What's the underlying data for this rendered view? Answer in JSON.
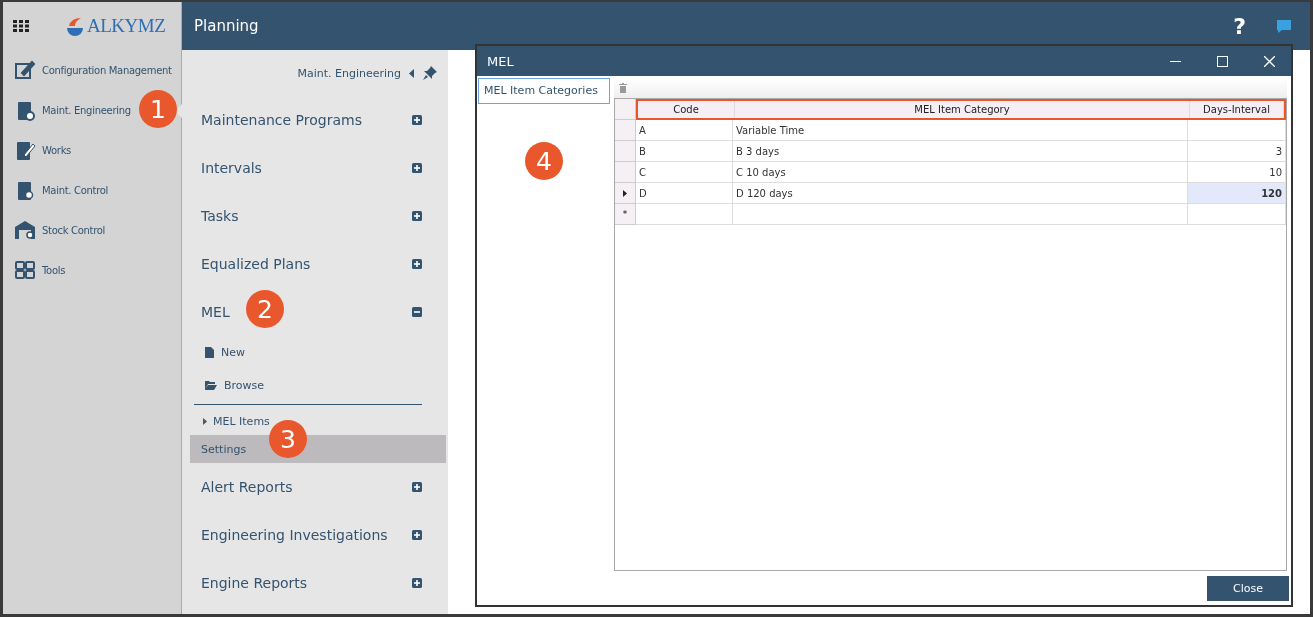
{
  "header": {
    "logo": "ALKYMZ",
    "title": "Planning",
    "help": "?"
  },
  "nav": [
    {
      "label": "Configuration Management",
      "selected": false
    },
    {
      "label": "Maint. Engineering",
      "selected": true
    },
    {
      "label": "Works",
      "selected": false
    },
    {
      "label": "Maint. Control",
      "selected": false
    },
    {
      "label": "Stock Control",
      "selected": false
    },
    {
      "label": "Tools",
      "selected": false
    }
  ],
  "panel": {
    "breadcrumb": "Maint. Engineering",
    "sections": [
      {
        "label": "Maintenance Programs",
        "expanded": false
      },
      {
        "label": "Intervals",
        "expanded": false
      },
      {
        "label": "Tasks",
        "expanded": false
      },
      {
        "label": "Equalized Plans",
        "expanded": false
      },
      {
        "label": "MEL",
        "expanded": true,
        "actions": [
          {
            "label": "New"
          },
          {
            "label": "Browse"
          }
        ],
        "items": [
          {
            "label": "MEL Items",
            "kind": "group",
            "selected": false
          },
          {
            "label": "Settings",
            "kind": "leaf",
            "selected": true
          }
        ]
      },
      {
        "label": "Alert Reports",
        "expanded": false
      },
      {
        "label": "Engineering Investigations",
        "expanded": false
      },
      {
        "label": "Engine Reports",
        "expanded": false
      }
    ]
  },
  "dialog": {
    "title": "MEL",
    "tabs": [
      {
        "label": "MEL Item Categories",
        "selected": true
      }
    ],
    "columns": [
      "Code",
      "MEL Item Category",
      "Days-Interval"
    ],
    "rows": [
      {
        "cells": [
          "A",
          "Variable Time",
          ""
        ],
        "current": false
      },
      {
        "cells": [
          "B",
          "B 3 days",
          "3"
        ],
        "current": false
      },
      {
        "cells": [
          "C",
          "C 10 days",
          "10"
        ],
        "current": false
      },
      {
        "cells": [
          "D",
          "D 120 days",
          "120"
        ],
        "current": true
      }
    ],
    "new_row_marker": "*",
    "button": "Close"
  },
  "callouts": [
    "1",
    "2",
    "3",
    "4"
  ]
}
